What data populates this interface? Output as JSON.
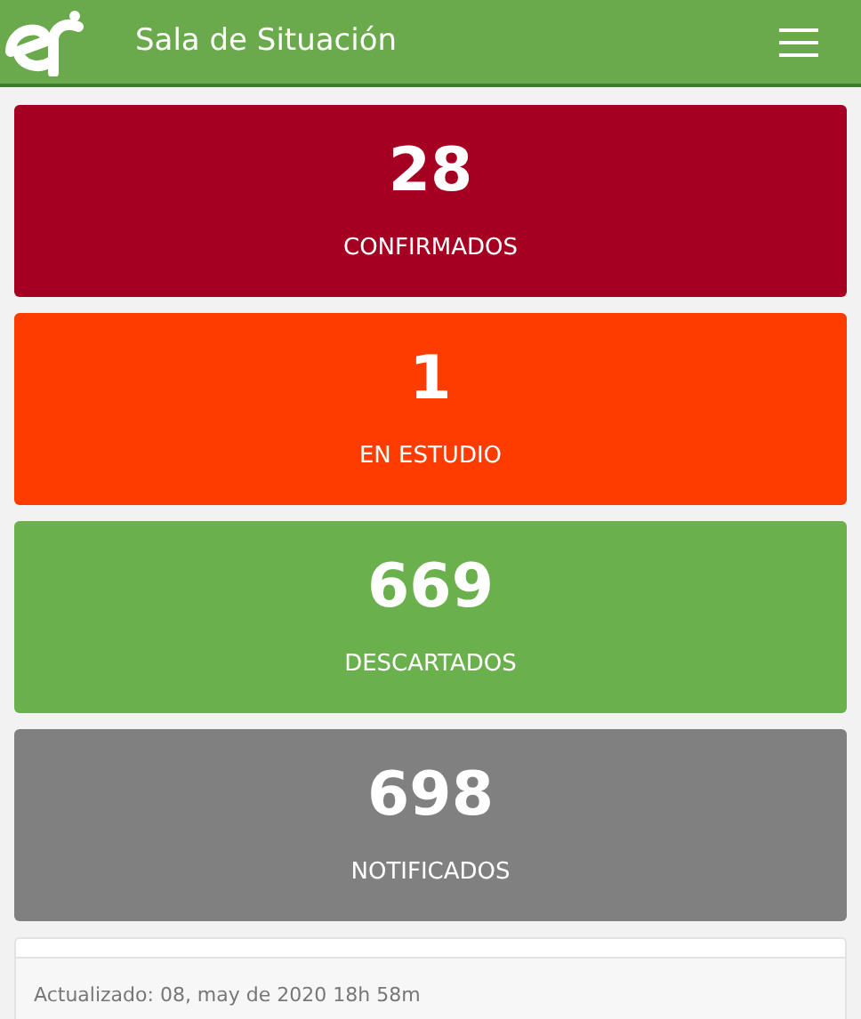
{
  "header": {
    "title": "Sala de Situación"
  },
  "stats": [
    {
      "value": "28",
      "label": "CONFIRMADOS",
      "color": "#a50021"
    },
    {
      "value": "1",
      "label": "EN ESTUDIO",
      "color": "#ff3c00"
    },
    {
      "value": "669",
      "label": "DESCARTADOS",
      "color": "#6ab04c"
    },
    {
      "value": "698",
      "label": "NOTIFICADOS",
      "color": "#808080"
    }
  ],
  "footer": {
    "updated": "Actualizado: 08, may de 2020 18h 58m"
  }
}
